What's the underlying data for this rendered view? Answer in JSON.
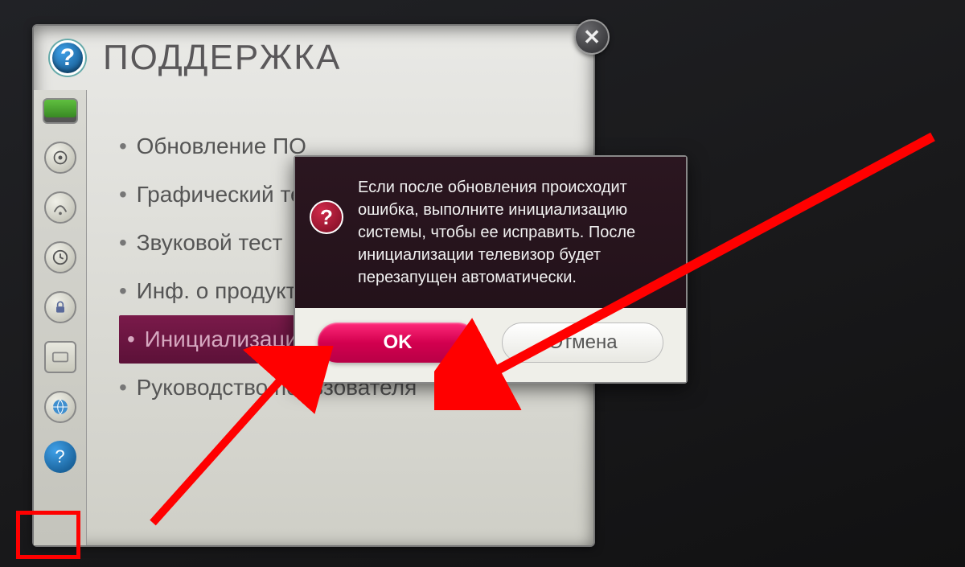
{
  "header": {
    "title": "ПОДДЕРЖКА",
    "close_glyph": "✕",
    "icon_glyph": "?"
  },
  "sidebar": {
    "items": [
      {
        "name": "picture-icon"
      },
      {
        "name": "sound-icon"
      },
      {
        "name": "channel-icon"
      },
      {
        "name": "time-icon"
      },
      {
        "name": "lock-icon"
      },
      {
        "name": "option-icon"
      },
      {
        "name": "network-icon"
      },
      {
        "name": "support-icon"
      }
    ],
    "support_glyph": "?"
  },
  "menu": {
    "items": [
      {
        "label": "Обновление ПО"
      },
      {
        "label": "Графический тест"
      },
      {
        "label": "Звуковой тест"
      },
      {
        "label": "Инф. о продукте"
      },
      {
        "label": "Инициализация",
        "selected": true
      },
      {
        "label": "Руководство пользователя"
      }
    ]
  },
  "dialog": {
    "icon_glyph": "?",
    "message": "Если после обновления происходит ошибка, выполните инициализацию системы, чтобы ее исправить. После инициализации телевизор будет перезапущен автоматически.",
    "ok_label": "OK",
    "cancel_label": "Отмена"
  },
  "colors": {
    "accent": "#d3004f",
    "annotation": "#ff0000"
  }
}
